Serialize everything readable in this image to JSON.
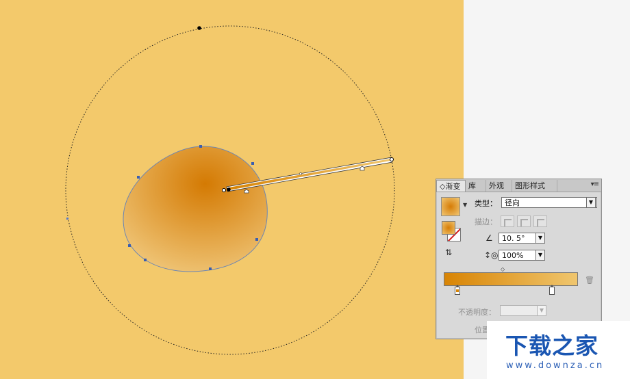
{
  "canvas": {
    "color": "#f3c96b"
  },
  "panel": {
    "tabs": [
      "◇渐变",
      "库",
      "外观",
      "图形样式"
    ],
    "menu_icon": "▾≡",
    "type_label": "类型：",
    "type_value": "径向",
    "stroke_label": "描边：",
    "angle_value": "10. 5°",
    "aspect_value": "100%",
    "opacity_label": "不透明度：",
    "position_label": "位置",
    "gradient_start": "#d88404",
    "gradient_end": "#f0c66e"
  },
  "watermark": {
    "title": "下载之家",
    "url": "www.downza.cn"
  }
}
